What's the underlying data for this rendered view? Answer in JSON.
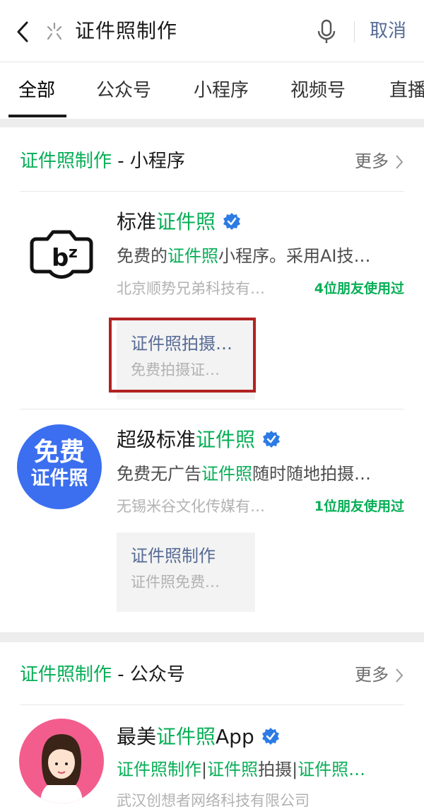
{
  "search": {
    "query": "证件照制作",
    "cancel_label": "取消"
  },
  "tabs": [
    {
      "label": "全部",
      "active": true
    },
    {
      "label": "公众号"
    },
    {
      "label": "小程序"
    },
    {
      "label": "视频号"
    },
    {
      "label": "直播"
    }
  ],
  "section_miniprogram": {
    "keyword": "证件照制作",
    "suffix": " - 小程序",
    "more_label": "更多",
    "items": [
      {
        "logo": "camera-logo-icon",
        "name_prefix": "标准",
        "name_highlight": "证件照",
        "name_suffix": "",
        "desc_prefix": "免费的",
        "desc_highlight": "证件照",
        "desc_suffix": "小程序。采用AI技…",
        "owner": "北京顺势兄弟科技有…",
        "friends": "4位朋友使用过",
        "sub_title": "证件照拍摄…",
        "sub_desc": "免费拍摄证…"
      },
      {
        "logo_line1": "免费",
        "logo_line2": "证件照",
        "name_prefix": "超级标准",
        "name_highlight": "证件照",
        "desc_prefix": "免费无广告",
        "desc_highlight": "证件照",
        "desc_suffix": "随时随地拍摄…",
        "owner": "无锡米谷文化传媒有…",
        "friends": "1位朋友使用过",
        "sub_title": "证件照制作",
        "sub_desc": "证件照免费…"
      }
    ]
  },
  "section_official": {
    "keyword": "证件照制作",
    "suffix": " - 公众号",
    "more_label": "更多",
    "item": {
      "name_prefix": "最美",
      "name_highlight": "证件照",
      "name_suffix": "App",
      "desc_part1": "证件照制作",
      "desc_sep1": "|",
      "desc_part2": "证件照",
      "desc_part2b": "拍摄",
      "desc_sep2": "|",
      "desc_part3": "证件照…",
      "owner": "武汉创想者网络科技有限公司"
    }
  },
  "colors": {
    "accent_green": "#06ae56",
    "link_blue": "#576b95",
    "highlight_red": "#b22222",
    "verify_blue": "#2c7be5"
  }
}
